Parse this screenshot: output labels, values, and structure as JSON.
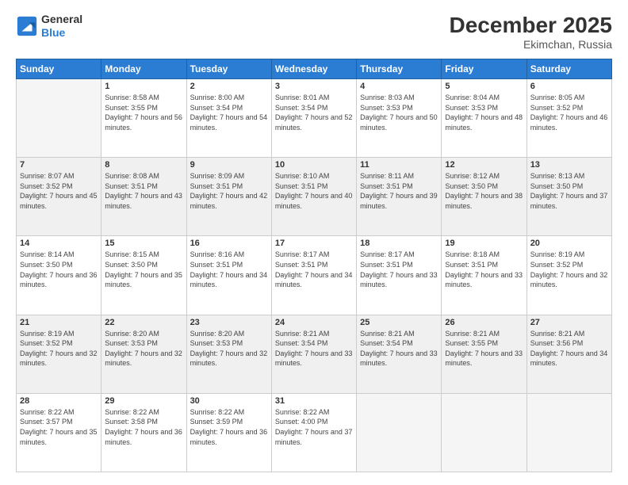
{
  "header": {
    "logo_line1": "General",
    "logo_line2": "Blue",
    "month": "December 2025",
    "location": "Ekimchan, Russia"
  },
  "weekdays": [
    "Sunday",
    "Monday",
    "Tuesday",
    "Wednesday",
    "Thursday",
    "Friday",
    "Saturday"
  ],
  "weeks": [
    [
      {
        "day": "",
        "empty": true
      },
      {
        "day": "1",
        "sunrise": "8:58 AM",
        "sunset": "3:55 PM",
        "daylight": "7 hours and 56 minutes."
      },
      {
        "day": "2",
        "sunrise": "8:00 AM",
        "sunset": "3:54 PM",
        "daylight": "7 hours and 54 minutes."
      },
      {
        "day": "3",
        "sunrise": "8:01 AM",
        "sunset": "3:54 PM",
        "daylight": "7 hours and 52 minutes."
      },
      {
        "day": "4",
        "sunrise": "8:03 AM",
        "sunset": "3:53 PM",
        "daylight": "7 hours and 50 minutes."
      },
      {
        "day": "5",
        "sunrise": "8:04 AM",
        "sunset": "3:53 PM",
        "daylight": "7 hours and 48 minutes."
      },
      {
        "day": "6",
        "sunrise": "8:05 AM",
        "sunset": "3:52 PM",
        "daylight": "7 hours and 46 minutes."
      }
    ],
    [
      {
        "day": "7",
        "sunrise": "8:07 AM",
        "sunset": "3:52 PM",
        "daylight": "7 hours and 45 minutes."
      },
      {
        "day": "8",
        "sunrise": "8:08 AM",
        "sunset": "3:51 PM",
        "daylight": "7 hours and 43 minutes."
      },
      {
        "day": "9",
        "sunrise": "8:09 AM",
        "sunset": "3:51 PM",
        "daylight": "7 hours and 42 minutes."
      },
      {
        "day": "10",
        "sunrise": "8:10 AM",
        "sunset": "3:51 PM",
        "daylight": "7 hours and 40 minutes."
      },
      {
        "day": "11",
        "sunrise": "8:11 AM",
        "sunset": "3:51 PM",
        "daylight": "7 hours and 39 minutes."
      },
      {
        "day": "12",
        "sunrise": "8:12 AM",
        "sunset": "3:50 PM",
        "daylight": "7 hours and 38 minutes."
      },
      {
        "day": "13",
        "sunrise": "8:13 AM",
        "sunset": "3:50 PM",
        "daylight": "7 hours and 37 minutes."
      }
    ],
    [
      {
        "day": "14",
        "sunrise": "8:14 AM",
        "sunset": "3:50 PM",
        "daylight": "7 hours and 36 minutes."
      },
      {
        "day": "15",
        "sunrise": "8:15 AM",
        "sunset": "3:50 PM",
        "daylight": "7 hours and 35 minutes."
      },
      {
        "day": "16",
        "sunrise": "8:16 AM",
        "sunset": "3:51 PM",
        "daylight": "7 hours and 34 minutes."
      },
      {
        "day": "17",
        "sunrise": "8:17 AM",
        "sunset": "3:51 PM",
        "daylight": "7 hours and 34 minutes."
      },
      {
        "day": "18",
        "sunrise": "8:17 AM",
        "sunset": "3:51 PM",
        "daylight": "7 hours and 33 minutes."
      },
      {
        "day": "19",
        "sunrise": "8:18 AM",
        "sunset": "3:51 PM",
        "daylight": "7 hours and 33 minutes."
      },
      {
        "day": "20",
        "sunrise": "8:19 AM",
        "sunset": "3:52 PM",
        "daylight": "7 hours and 32 minutes."
      }
    ],
    [
      {
        "day": "21",
        "sunrise": "8:19 AM",
        "sunset": "3:52 PM",
        "daylight": "7 hours and 32 minutes."
      },
      {
        "day": "22",
        "sunrise": "8:20 AM",
        "sunset": "3:53 PM",
        "daylight": "7 hours and 32 minutes."
      },
      {
        "day": "23",
        "sunrise": "8:20 AM",
        "sunset": "3:53 PM",
        "daylight": "7 hours and 32 minutes."
      },
      {
        "day": "24",
        "sunrise": "8:21 AM",
        "sunset": "3:54 PM",
        "daylight": "7 hours and 33 minutes."
      },
      {
        "day": "25",
        "sunrise": "8:21 AM",
        "sunset": "3:54 PM",
        "daylight": "7 hours and 33 minutes."
      },
      {
        "day": "26",
        "sunrise": "8:21 AM",
        "sunset": "3:55 PM",
        "daylight": "7 hours and 33 minutes."
      },
      {
        "day": "27",
        "sunrise": "8:21 AM",
        "sunset": "3:56 PM",
        "daylight": "7 hours and 34 minutes."
      }
    ],
    [
      {
        "day": "28",
        "sunrise": "8:22 AM",
        "sunset": "3:57 PM",
        "daylight": "7 hours and 35 minutes."
      },
      {
        "day": "29",
        "sunrise": "8:22 AM",
        "sunset": "3:58 PM",
        "daylight": "7 hours and 36 minutes."
      },
      {
        "day": "30",
        "sunrise": "8:22 AM",
        "sunset": "3:59 PM",
        "daylight": "7 hours and 36 minutes."
      },
      {
        "day": "31",
        "sunrise": "8:22 AM",
        "sunset": "4:00 PM",
        "daylight": "7 hours and 37 minutes."
      },
      {
        "day": "",
        "empty": true
      },
      {
        "day": "",
        "empty": true
      },
      {
        "day": "",
        "empty": true
      }
    ]
  ]
}
